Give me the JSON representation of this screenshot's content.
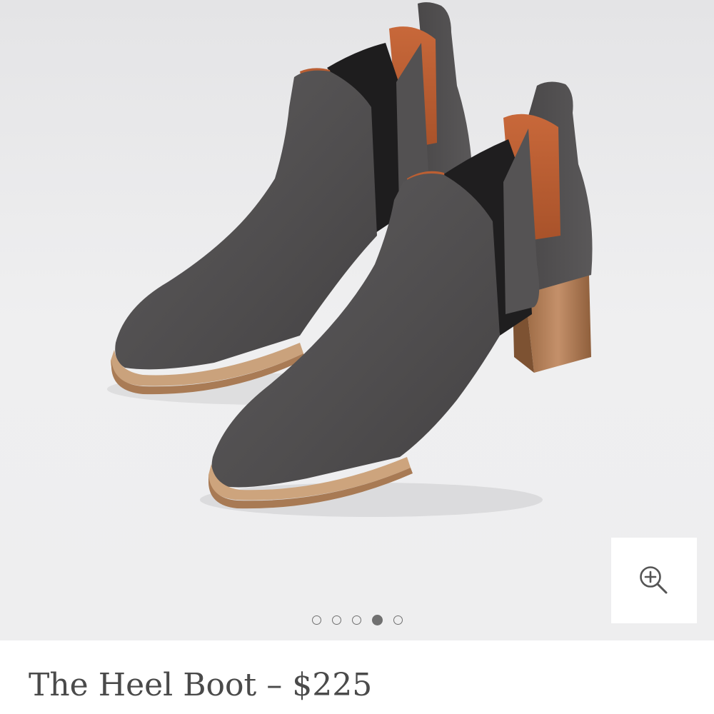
{
  "product": {
    "name": "The Heel Boot",
    "separator": "–",
    "price": "$225"
  },
  "gallery": {
    "image_subject": "grey suede heeled chelsea boots",
    "slide_count": 5,
    "active_slide": 4,
    "background_color": "#eeeeef",
    "zoom_icon": "zoom-in-icon"
  }
}
